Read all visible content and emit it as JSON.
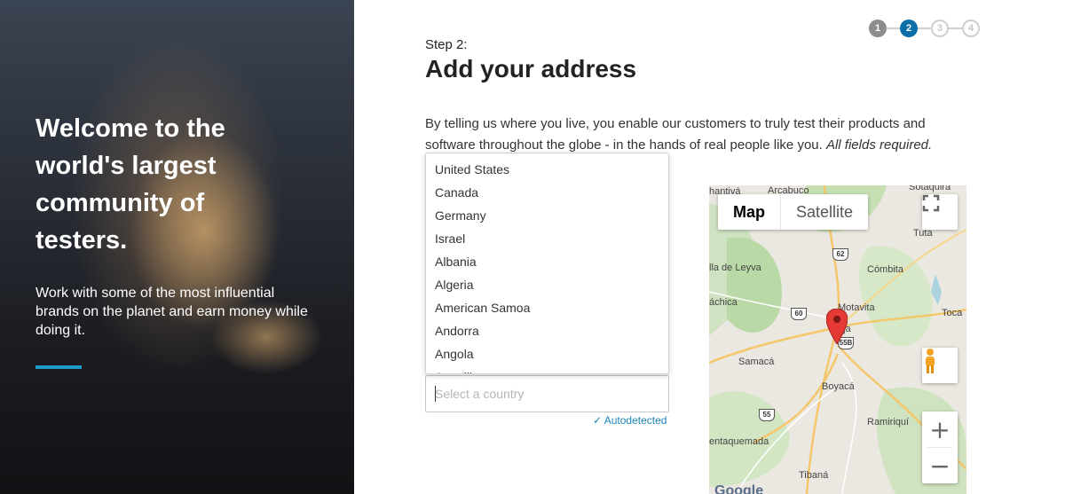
{
  "hero": {
    "title": "Welcome to the world's largest community of testers.",
    "subtitle": "Work with some of the most influential brands on the planet and earn money while doing it.",
    "accent_color": "#1d9bc9"
  },
  "stepper": {
    "steps": [
      "1",
      "2",
      "3",
      "4"
    ],
    "current": 2
  },
  "form": {
    "step_label": "Step 2:",
    "title": "Add your address",
    "intro": "By telling us where you live, you enable our customers to truly test their products and software throughout the globe - in the hands of real people like you.",
    "intro_required": "All fields required.",
    "country": {
      "placeholder": "Select a country",
      "value": "",
      "autodetected": "Autodetected",
      "options": [
        "United States",
        "Canada",
        "Germany",
        "Israel",
        "Albania",
        "Algeria",
        "American Samoa",
        "Andorra",
        "Angola",
        "Anguilla"
      ]
    }
  },
  "map": {
    "mode_map": "Map",
    "mode_satellite": "Satellite",
    "zoom_in": "+",
    "zoom_out": "−",
    "attribution": "Google",
    "places": [
      "Sotaquirá",
      "Arcabuco",
      "hantivá",
      "Tuta",
      "Cómbita",
      "lla de Leyva",
      "áchica",
      "Motavita",
      "Toca",
      "nja",
      "Samacá",
      "Boyacá",
      "Ramiriquí",
      "entaquemada",
      "Tibaná"
    ],
    "routes": [
      "62",
      "60",
      "55B",
      "55"
    ],
    "marker_color": "#e53935"
  }
}
